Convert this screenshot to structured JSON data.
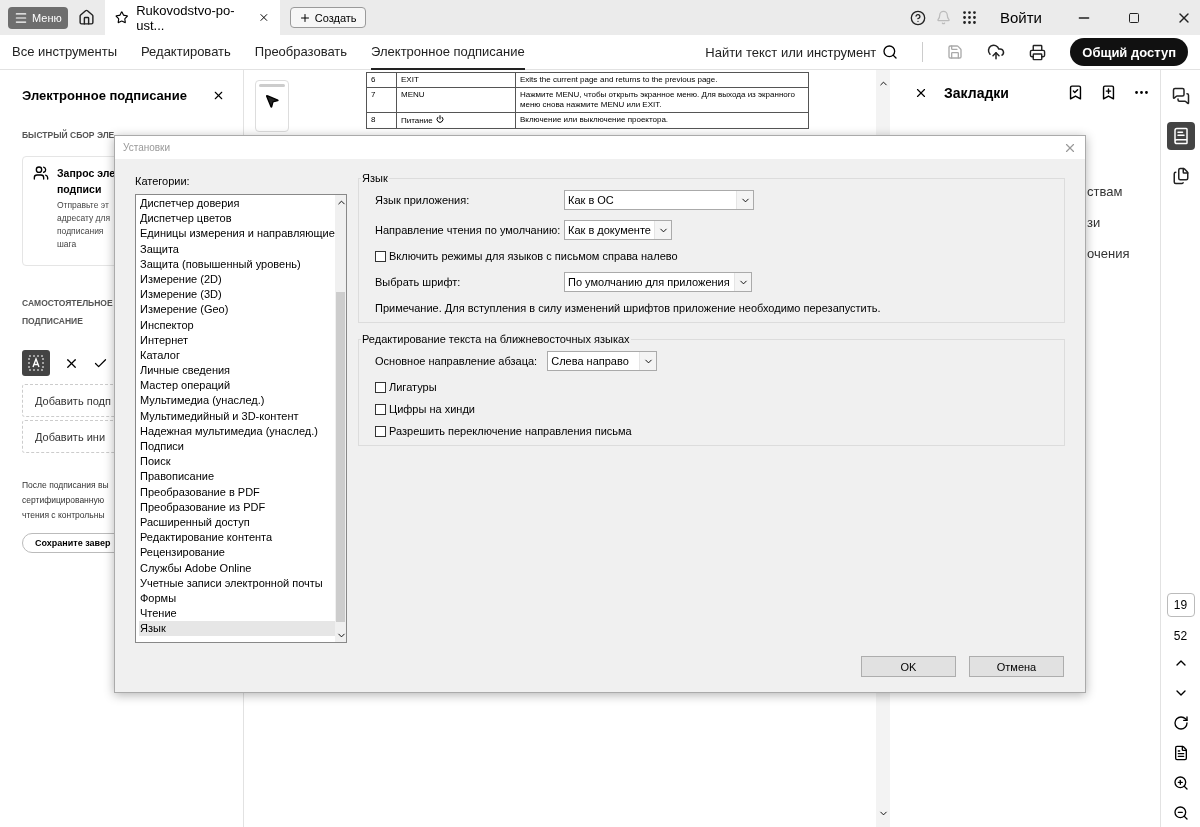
{
  "app_bar": {
    "menu_button": "Меню",
    "tab": {
      "title": "Rukovodstvo-po-ust..."
    },
    "create_button": "Создать",
    "sign_in": "Войти"
  },
  "toolbar": {
    "tabs": [
      {
        "label": "Все инструменты",
        "selected": false
      },
      {
        "label": "Редактировать",
        "selected": false
      },
      {
        "label": "Преобразовать",
        "selected": false
      },
      {
        "label": "Электронное подписание",
        "selected": true
      }
    ],
    "search": "Найти текст или инструмент",
    "share_button": "Общий доступ"
  },
  "left_panel": {
    "title": "Электронное подписание",
    "quick_section": "БЫСТРЫЙ СБОР ЭЛЕ",
    "request_card": {
      "title_lines": [
        "Запрос эле",
        "подписи"
      ],
      "description_lines": [
        "Отправьте эт",
        "адресату для",
        "подписания",
        "шага"
      ]
    },
    "self_section_lines": [
      "САМОСТОЯТЕЛЬНОЕ",
      "ПОДПИСАНИЕ"
    ],
    "field_buttons": [
      "Добавить подп",
      "Добавить ини"
    ],
    "note_lines": [
      "После подписания вы",
      "сертифицированную",
      "чтения с контрольны"
    ],
    "save_button": "Сохраните завер"
  },
  "document": {
    "rows": [
      {
        "number": "6",
        "key": "EXIT",
        "description": "Exits the current page and returns to the previous page.",
        "power": false
      },
      {
        "number": "7",
        "key": "MENU",
        "description": "Нажмите MENU, чтобы открыть экранное меню. Для выхода из экранного меню снова нажмите MENU или EXIT.",
        "power": false
      },
      {
        "number": "8",
        "key": "Питание",
        "description": "Включение или выключение проектора.",
        "power": true
      }
    ]
  },
  "bookmarks": {
    "title": "Закладки",
    "items": [
      "ствам",
      "зи",
      "очения"
    ]
  },
  "page_nav": {
    "current": "19",
    "total": "52"
  },
  "dialog": {
    "title": "Установки",
    "categories_label": "Категории:",
    "categories": [
      {
        "label": "Диспетчер доверия",
        "selected": false
      },
      {
        "label": "Диспетчер цветов",
        "selected": false
      },
      {
        "label": "Единицы измерения и направляющие",
        "selected": false
      },
      {
        "label": "Защита",
        "selected": false
      },
      {
        "label": "Защита (повышенный уровень)",
        "selected": false
      },
      {
        "label": "Измерение (2D)",
        "selected": false
      },
      {
        "label": "Измерение (3D)",
        "selected": false
      },
      {
        "label": "Измерение (Geo)",
        "selected": false
      },
      {
        "label": "Инспектор",
        "selected": false
      },
      {
        "label": "Интернет",
        "selected": false
      },
      {
        "label": "Каталог",
        "selected": false
      },
      {
        "label": "Личные сведения",
        "selected": false
      },
      {
        "label": "Мастер операций",
        "selected": false
      },
      {
        "label": "Мультимедиа (унаслед.)",
        "selected": false
      },
      {
        "label": "Мультимедийный и 3D-контент",
        "selected": false
      },
      {
        "label": "Надежная мультимедиа (унаслед.)",
        "selected": false
      },
      {
        "label": "Подписи",
        "selected": false
      },
      {
        "label": "Поиск",
        "selected": false
      },
      {
        "label": "Правописание",
        "selected": false
      },
      {
        "label": "Преобразование в PDF",
        "selected": false
      },
      {
        "label": "Преобразование из PDF",
        "selected": false
      },
      {
        "label": "Расширенный доступ",
        "selected": false
      },
      {
        "label": "Редактирование контента",
        "selected": false
      },
      {
        "label": "Рецензирование",
        "selected": false
      },
      {
        "label": "Службы Adobe Online",
        "selected": false
      },
      {
        "label": "Учетные записи электронной почты",
        "selected": false
      },
      {
        "label": "Формы",
        "selected": false
      },
      {
        "label": "Чтение",
        "selected": false
      },
      {
        "label": "Язык",
        "selected": true
      }
    ],
    "groups": [
      {
        "title": "Язык",
        "rows": [
          {
            "kind": "select",
            "label": "Язык приложения:",
            "value": "Как в ОС"
          },
          {
            "kind": "select",
            "label": "Направление чтения по умолчанию:",
            "value": "Как в документе"
          },
          {
            "kind": "checkbox",
            "label": "Включить режимы для языков с письмом справа налево",
            "checked": false
          },
          {
            "kind": "select",
            "label": "Выбрать шрифт:",
            "value": "По умолчанию для приложения"
          },
          {
            "kind": "note",
            "label": "Примечание. Для вступления в силу изменений шрифтов приложение необходимо перезапустить."
          }
        ]
      },
      {
        "title": "Редактирование текста на ближневосточных языках",
        "rows": [
          {
            "kind": "inline_select",
            "label": "Основное направление абзаца:",
            "value": "Слева направо"
          },
          {
            "kind": "checkbox",
            "label": "Лигатуры",
            "checked": false
          },
          {
            "kind": "checkbox",
            "label": "Цифры на хинди",
            "checked": false
          },
          {
            "kind": "checkbox",
            "label": "Разрешить переключение направления письма",
            "checked": false
          }
        ]
      }
    ],
    "buttons": [
      "OK",
      "Отмена"
    ]
  }
}
